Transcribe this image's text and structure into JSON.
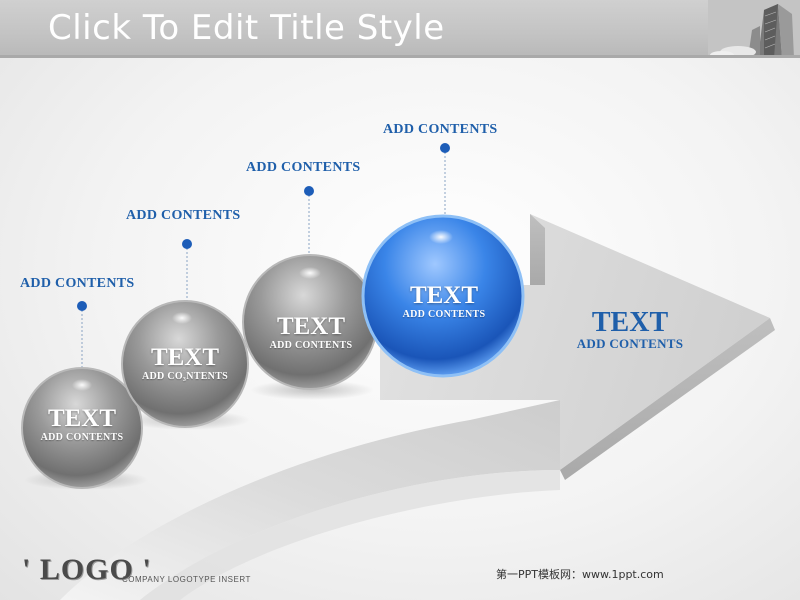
{
  "slide": {
    "title": "Click To Edit Title Style",
    "building_icon": "building-photo"
  },
  "steps": [
    {
      "label": "ADD CONTENTS",
      "ball_title": "TEXT",
      "ball_sub": "ADD CONTENTS",
      "color": "#8a8a8a"
    },
    {
      "label": "ADD CONTENTS",
      "ball_title": "TEXT",
      "ball_sub": "ADD CO₃NTENTS",
      "color": "#8a8a8a"
    },
    {
      "label": "ADD CONTENTS",
      "ball_title": "TEXT",
      "ball_sub": "ADD CONTENTS",
      "color": "#8a8a8a"
    },
    {
      "label": "ADD CONTENTS",
      "ball_title": "TEXT",
      "ball_sub": "ADD CONTENTS",
      "color": "#1e66c9"
    }
  ],
  "arrow": {
    "title": "TEXT",
    "subtitle": "ADD CONTENTS"
  },
  "footer": {
    "logo": "' LOGO '",
    "logotype": "COMPANY LOGOTYPE INSERT",
    "credit": "第一PPT模板网：www.1ppt.com"
  },
  "colors": {
    "accent": "#1f5faa",
    "dot": "#1d5db8",
    "ball_grey": "#8a8a8a",
    "ball_blue": "#1e66c9"
  }
}
